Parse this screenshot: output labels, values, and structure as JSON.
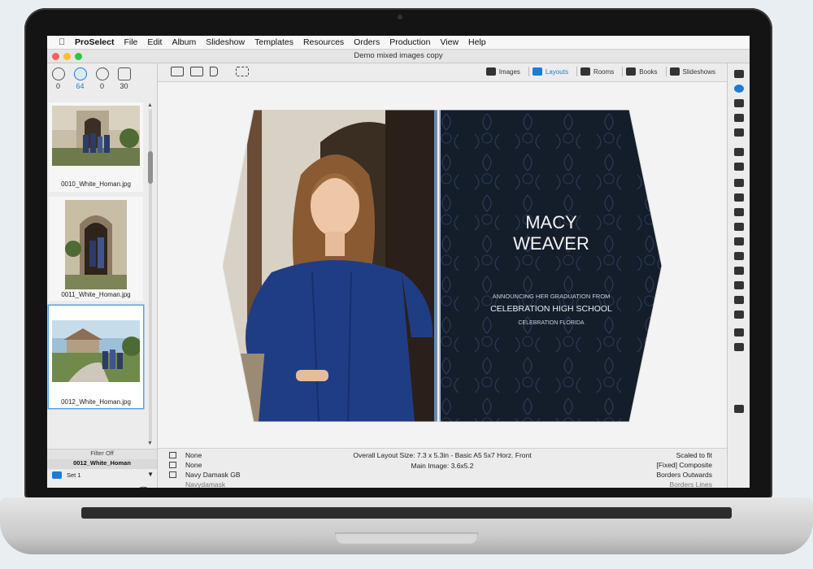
{
  "menubar": {
    "app": "ProSelect",
    "items": [
      "File",
      "Edit",
      "Album",
      "Slideshow",
      "Templates",
      "Resources",
      "Orders",
      "Production",
      "View",
      "Help"
    ]
  },
  "window": {
    "title": "Demo mixed images copy"
  },
  "filter_tabs": [
    {
      "count": "0",
      "icon": "smiley-icon"
    },
    {
      "count": "64",
      "icon": "face-icon",
      "active": true
    },
    {
      "count": "0",
      "icon": "reject-icon"
    },
    {
      "count": "30",
      "icon": "album-icon"
    }
  ],
  "thumbnails": [
    {
      "name": "0010_White_Homan.jpg"
    },
    {
      "name": "0011_White_Homan.jpg"
    },
    {
      "name": "0012_White_Homan.jpg",
      "selected": true
    }
  ],
  "left_panel": {
    "filter_label": "Filter Off",
    "current_file": "0012_White_Homan",
    "set_label": "Set 1"
  },
  "modes": [
    {
      "label": "Images",
      "icon": "images-icon"
    },
    {
      "label": "Layouts",
      "icon": "layouts-icon",
      "active": true
    },
    {
      "label": "Rooms",
      "icon": "rooms-icon"
    },
    {
      "label": "Books",
      "icon": "books-icon"
    },
    {
      "label": "Slideshows",
      "icon": "slideshows-icon"
    }
  ],
  "layout_text": {
    "name_line1": "MACY",
    "name_line2": "WEAVER",
    "announce": "ANNOUNCING HER GRADUATION FROM",
    "school": "CELEBRATION HIGH SCHOOL",
    "location": "CELEBRATION FLORIDA"
  },
  "status": {
    "left1": "None",
    "left2": "None",
    "left3": "Navy Damask GB",
    "left4": "Navydamask",
    "layout_size": "Overall Layout Size: 7.3 x 5.3in - Basic A5 5x7 Horz. Front",
    "main_image": "Main Image: 3.6x5.2",
    "right1": "Scaled to fit",
    "right2": "[Fixed] Composite",
    "right3": "Borders Outwards",
    "right4": "Borders Lines"
  },
  "colors": {
    "accent": "#1d7bd8",
    "panel_navy": "#15202e",
    "dress_blue": "#1f3d85"
  }
}
